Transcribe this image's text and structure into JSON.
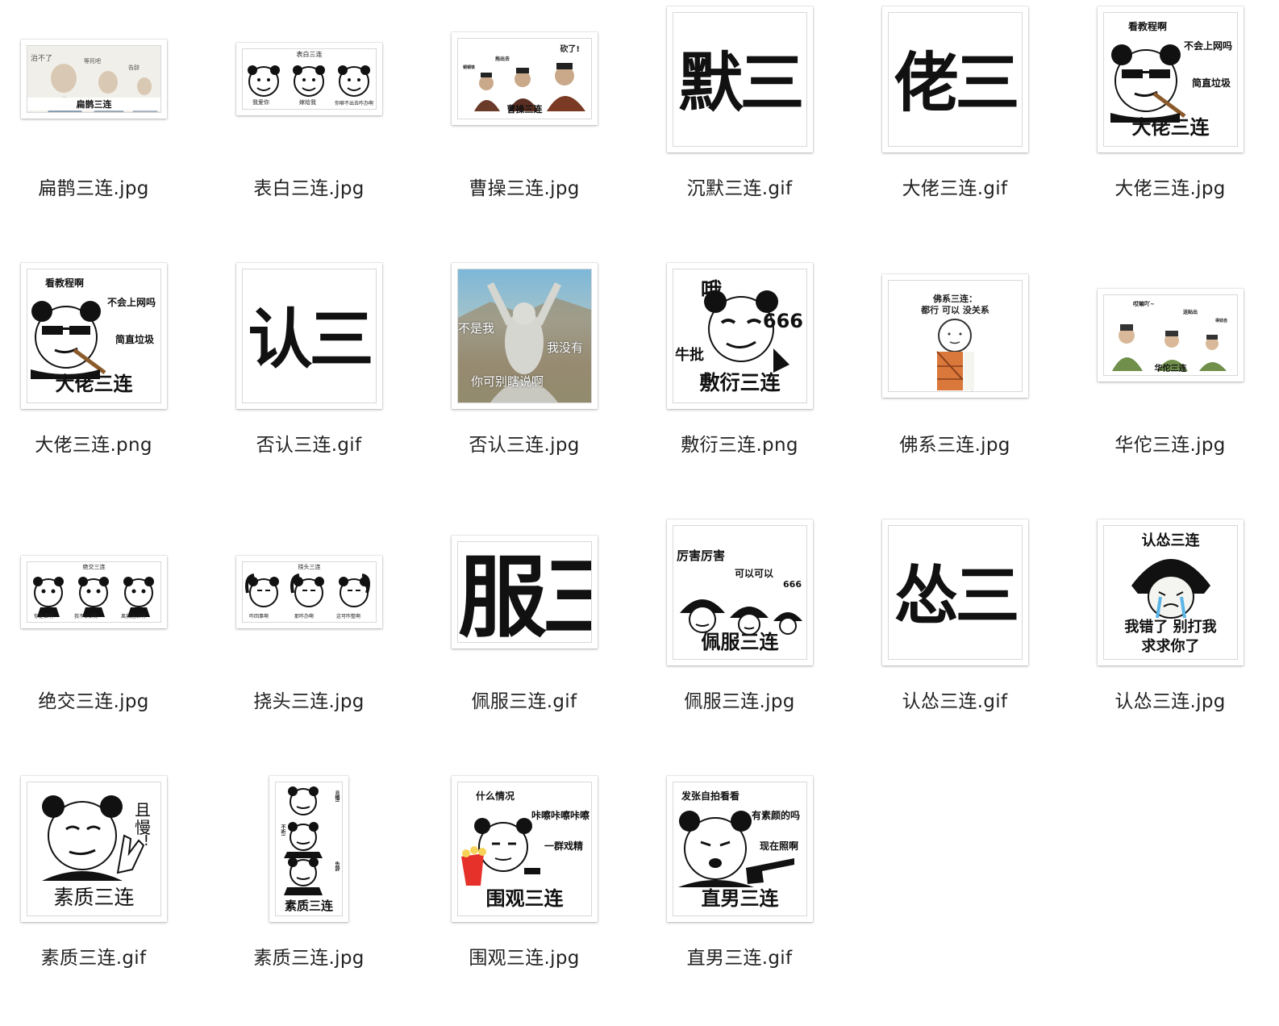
{
  "files": [
    {
      "name": "扁鹊三连.jpg",
      "caption": "扁鹊三连",
      "texts": [
        "治不了",
        "等死吧",
        "告辞"
      ]
    },
    {
      "name": "表白三连.jpg",
      "caption": "表白三连",
      "texts": [
        "我爱你",
        "嫁给我",
        "你噼不出去咋办啊"
      ]
    },
    {
      "name": "曹操三连.jpg",
      "caption": "曹操三连",
      "texts": [
        "砍了!",
        "拖出去",
        "铜铜铁"
      ]
    },
    {
      "name": "沉默三连.gif",
      "big": "默三"
    },
    {
      "name": "大佬三连.gif",
      "big": "佬三"
    },
    {
      "name": "大佬三连.jpg",
      "caption": "大佬三连",
      "texts": [
        "看教程啊",
        "不会上网吗",
        "简直垃圾"
      ]
    },
    {
      "name": "大佬三连.png",
      "caption": "大佬三连",
      "texts": [
        "看教程啊",
        "不会上网吗",
        "简直垃圾"
      ]
    },
    {
      "name": "否认三连.gif",
      "big": "认三"
    },
    {
      "name": "否认三连.jpg",
      "texts": [
        "不是我",
        "我没有",
        "你可别瞎说啊"
      ]
    },
    {
      "name": "敷衍三连.png",
      "caption": "敷衍三连",
      "texts": [
        "哦",
        "666",
        "牛批"
      ]
    },
    {
      "name": "佛系三连.jpg",
      "texts": [
        "佛系三连：",
        "都行 可以 没关系"
      ]
    },
    {
      "name": "华佗三连.jpg",
      "caption": "华佗三连",
      "texts": [
        "哎嘛吖~",
        "送贴出",
        "得劲自"
      ]
    },
    {
      "name": "绝交三连.jpg",
      "caption": "绝交三连",
      "texts": [
        "你是谁啊",
        "我不认识你",
        "离我远点啊"
      ]
    },
    {
      "name": "挠头三连.jpg",
      "caption": "挠头三连",
      "texts": [
        "咋回事啊",
        "那咋办啊",
        "这可咋整啊"
      ]
    },
    {
      "name": "佩服三连.gif",
      "big": "服三"
    },
    {
      "name": "佩服三连.jpg",
      "caption": "佩服三连",
      "texts": [
        "厉害厉害",
        "可以可以",
        "666"
      ]
    },
    {
      "name": "认怂三连.gif",
      "big": "怂三"
    },
    {
      "name": "认怂三连.jpg",
      "caption": "认怂三连",
      "texts": [
        "我错了 别打我",
        "求求你了"
      ]
    },
    {
      "name": "素质三连.gif",
      "caption": "素质三连",
      "texts": [
        "且",
        "慢",
        "!"
      ]
    },
    {
      "name": "素质三连.jpg",
      "caption": "素质三连",
      "texts": [
        "且慢!",
        "不听!",
        "告辞"
      ]
    },
    {
      "name": "围观三连.jpg",
      "caption": "围观三连",
      "texts": [
        "什么情况",
        "咔嚓咔嚓咔嚓",
        "一群戏精"
      ]
    },
    {
      "name": "直男三连.gif",
      "caption": "直男三连",
      "texts": [
        "发张自拍看看",
        "有素颜的吗",
        "现在照啊"
      ]
    }
  ]
}
